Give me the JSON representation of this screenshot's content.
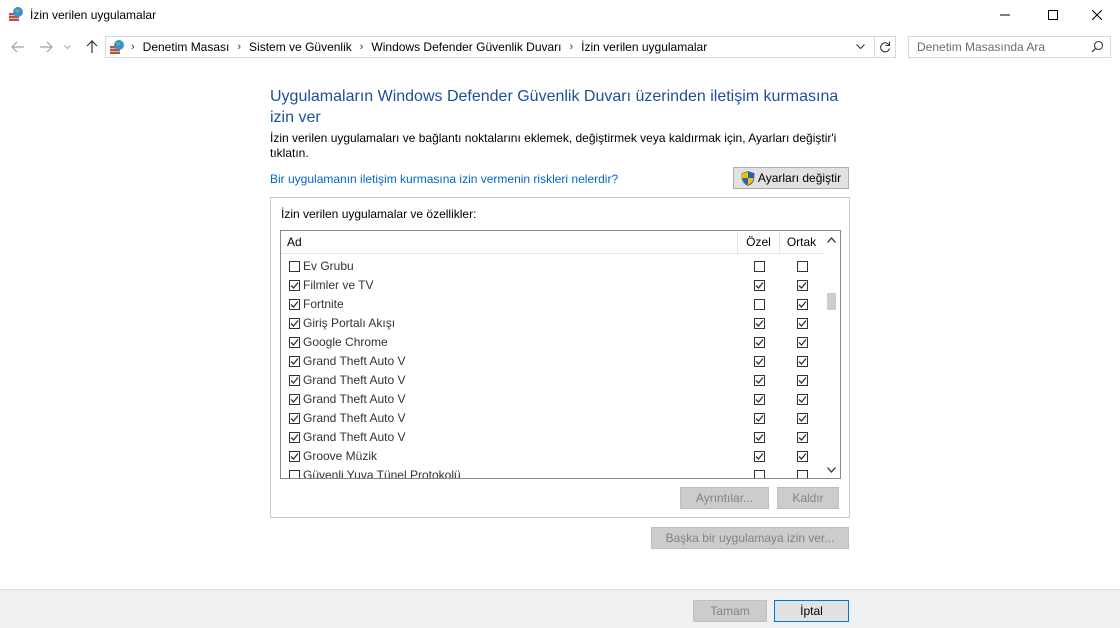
{
  "window": {
    "title": "İzin verilen uygulamalar",
    "icon": "firewall-app-icon",
    "controls": [
      "minimize-icon",
      "maximize-icon",
      "close-icon"
    ]
  },
  "address_bar": {
    "breadcrumbs": [
      "Denetim Masası",
      "Sistem ve Güvenlik",
      "Windows Defender Güvenlik Duvarı",
      "İzin verilen uygulamalar"
    ],
    "search_placeholder": "Denetim Masasında Ara"
  },
  "content": {
    "title": "Uygulamaların Windows Defender Güvenlik Duvarı üzerinden iletişim kurmasına izin ver",
    "description": "İzin verilen uygulamaları ve bağlantı noktalarını eklemek, değiştirmek veya kaldırmak için, Ayarları değiştir'i tıklatın.",
    "risk_link": "Bir uygulamanın iletişim kurmasına izin vermenin riskleri nelerdir?",
    "change_settings_label": "Ayarları değiştir"
  },
  "apps_group": {
    "label": "İzin verilen uygulamalar ve özellikler:",
    "columns": {
      "name": "Ad",
      "private": "Özel",
      "public": "Ortak"
    },
    "rows": [
      {
        "name": "Ev Grubu",
        "enabled": false,
        "private": false,
        "public": false
      },
      {
        "name": "Filmler ve TV",
        "enabled": true,
        "private": true,
        "public": true
      },
      {
        "name": "Fortnite",
        "enabled": true,
        "private": false,
        "public": true
      },
      {
        "name": "Giriş Portalı Akışı",
        "enabled": true,
        "private": true,
        "public": true
      },
      {
        "name": "Google Chrome",
        "enabled": true,
        "private": true,
        "public": true
      },
      {
        "name": "Grand Theft Auto V",
        "enabled": true,
        "private": true,
        "public": true
      },
      {
        "name": "Grand Theft Auto V",
        "enabled": true,
        "private": true,
        "public": true
      },
      {
        "name": "Grand Theft Auto V",
        "enabled": true,
        "private": true,
        "public": true
      },
      {
        "name": "Grand Theft Auto V",
        "enabled": true,
        "private": true,
        "public": true
      },
      {
        "name": "Grand Theft Auto V",
        "enabled": true,
        "private": true,
        "public": true
      },
      {
        "name": "Groove Müzik",
        "enabled": true,
        "private": true,
        "public": true
      },
      {
        "name": "Güvenli Yuva Tünel Protokolü",
        "enabled": false,
        "private": false,
        "public": false
      }
    ],
    "details_label": "Ayrıntılar...",
    "remove_label": "Kaldır"
  },
  "allow_other_label": "Başka bir uygulamaya izin ver...",
  "footer": {
    "ok_label": "Tamam",
    "cancel_label": "İptal"
  }
}
